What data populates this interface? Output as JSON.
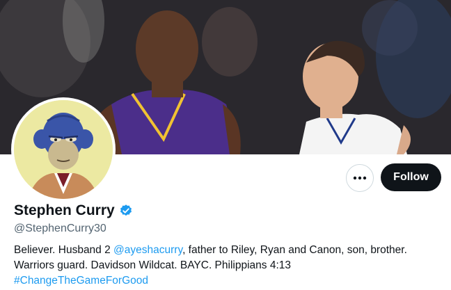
{
  "profile": {
    "name": "Stephen Curry",
    "handle": "@StephenCurry30",
    "verified_color": "#1d9bf0",
    "bio_line1_text1": "Believer. Husband 2 ",
    "bio_mention": "@ayeshacurry",
    "bio_line1_text2": ", father to Riley, Ryan and Canon, son, brother.",
    "bio_line2": "Warriors guard. Davidson Wildcat. BAYC. Philippians 4:13",
    "bio_hashtag": "#ChangeTheGameForGood"
  },
  "actions": {
    "follow_label": "Follow",
    "more_icon": "more-horizontal-icon"
  },
  "colors": {
    "accent": "#1d9bf0",
    "follow_bg": "#0f1419",
    "avatar_bg": "#ece9a2"
  }
}
